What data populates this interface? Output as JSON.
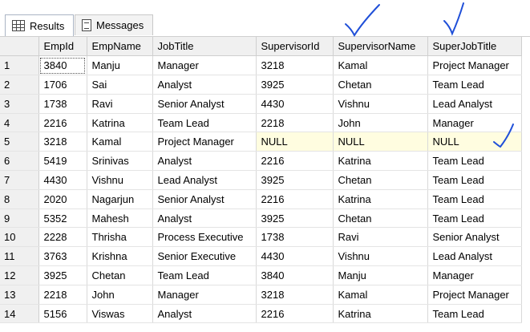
{
  "tabs": [
    {
      "label": "Results",
      "icon": "grid-icon",
      "active": true
    },
    {
      "label": "Messages",
      "icon": "messages-icon",
      "active": false
    }
  ],
  "columns": [
    "",
    "EmpId",
    "EmpName",
    "JobTitle",
    "SupervisorId",
    "SupervisorName",
    "SuperJobTitle"
  ],
  "rows": [
    [
      "1",
      "3840",
      "Manju",
      "Manager",
      "3218",
      "Kamal",
      "Project Manager"
    ],
    [
      "2",
      "1706",
      "Sai",
      "Analyst",
      "3925",
      "Chetan",
      "Team Lead"
    ],
    [
      "3",
      "1738",
      "Ravi",
      "Senior Analyst",
      "4430",
      "Vishnu",
      "Lead Analyst"
    ],
    [
      "4",
      "2216",
      "Katrina",
      "Team Lead",
      "2218",
      "John",
      "Manager"
    ],
    [
      "5",
      "3218",
      "Kamal",
      "Project Manager",
      "NULL",
      "NULL",
      "NULL"
    ],
    [
      "6",
      "5419",
      "Srinivas",
      "Analyst",
      "2216",
      "Katrina",
      "Team Lead"
    ],
    [
      "7",
      "4430",
      "Vishnu",
      "Lead Analyst",
      "3925",
      "Chetan",
      "Team Lead"
    ],
    [
      "8",
      "2020",
      "Nagarjun",
      "Senior Analyst",
      "2216",
      "Katrina",
      "Team Lead"
    ],
    [
      "9",
      "5352",
      "Mahesh",
      "Analyst",
      "3925",
      "Chetan",
      "Team Lead"
    ],
    [
      "10",
      "2228",
      "Thrisha",
      "Process Executive",
      "1738",
      "Ravi",
      "Senior Analyst"
    ],
    [
      "11",
      "3763",
      "Krishna",
      "Senior Executive",
      "4430",
      "Vishnu",
      "Lead Analyst"
    ],
    [
      "12",
      "3925",
      "Chetan",
      "Team Lead",
      "3840",
      "Manju",
      "Manager"
    ],
    [
      "13",
      "2218",
      "John",
      "Manager",
      "3218",
      "Kamal",
      "Project Manager"
    ],
    [
      "14",
      "5156",
      "Viswas",
      "Analyst",
      "2216",
      "Katrina",
      "Team Lead"
    ]
  ],
  "highlight_row_index": 4,
  "selected_cell": [
    0,
    1
  ],
  "annotation_color": "#1f4fd8",
  "null_highlight_color": "#fffde0"
}
